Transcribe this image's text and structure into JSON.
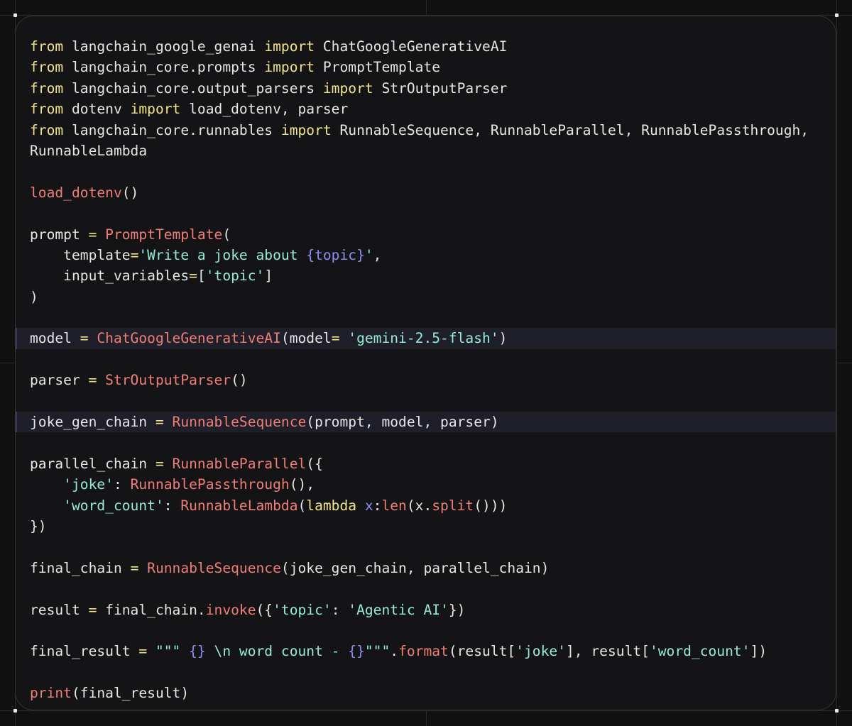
{
  "code_lines": [
    {
      "highlight": false,
      "tokens": [
        {
          "t": "kw",
          "v": "from"
        },
        {
          "t": "pl",
          "v": " langchain_google_genai "
        },
        {
          "t": "kw",
          "v": "import"
        },
        {
          "t": "pl",
          "v": " ChatGoogleGenerativeAI"
        }
      ]
    },
    {
      "highlight": false,
      "tokens": [
        {
          "t": "kw",
          "v": "from"
        },
        {
          "t": "pl",
          "v": " langchain_core.prompts "
        },
        {
          "t": "kw",
          "v": "import"
        },
        {
          "t": "pl",
          "v": " PromptTemplate"
        }
      ]
    },
    {
      "highlight": false,
      "tokens": [
        {
          "t": "kw",
          "v": "from"
        },
        {
          "t": "pl",
          "v": " langchain_core.output_parsers "
        },
        {
          "t": "kw",
          "v": "import"
        },
        {
          "t": "pl",
          "v": " StrOutputParser"
        }
      ]
    },
    {
      "highlight": false,
      "tokens": [
        {
          "t": "kw",
          "v": "from"
        },
        {
          "t": "pl",
          "v": " dotenv "
        },
        {
          "t": "kw",
          "v": "import"
        },
        {
          "t": "pl",
          "v": " load_dotenv, parser"
        }
      ]
    },
    {
      "highlight": false,
      "tokens": [
        {
          "t": "kw",
          "v": "from"
        },
        {
          "t": "pl",
          "v": " langchain_core.runnables "
        },
        {
          "t": "kw",
          "v": "import"
        },
        {
          "t": "pl",
          "v": " RunnableSequence, RunnableParallel, RunnablePassthrough,"
        }
      ]
    },
    {
      "highlight": false,
      "tokens": [
        {
          "t": "pl",
          "v": "RunnableLambda"
        }
      ]
    },
    {
      "highlight": false,
      "tokens": []
    },
    {
      "highlight": false,
      "tokens": [
        {
          "t": "fn",
          "v": "load_dotenv"
        },
        {
          "t": "pl",
          "v": "()"
        }
      ]
    },
    {
      "highlight": false,
      "tokens": []
    },
    {
      "highlight": false,
      "tokens": [
        {
          "t": "pl",
          "v": "prompt "
        },
        {
          "t": "op",
          "v": "="
        },
        {
          "t": "pl",
          "v": " "
        },
        {
          "t": "fn",
          "v": "PromptTemplate"
        },
        {
          "t": "pl",
          "v": "("
        }
      ]
    },
    {
      "highlight": false,
      "tokens": [
        {
          "t": "pl",
          "v": "    template"
        },
        {
          "t": "op",
          "v": "="
        },
        {
          "t": "str",
          "v": "'Write a joke about "
        },
        {
          "t": "ph",
          "v": "{topic}"
        },
        {
          "t": "str",
          "v": "'"
        },
        {
          "t": "pl",
          "v": ","
        }
      ]
    },
    {
      "highlight": false,
      "tokens": [
        {
          "t": "pl",
          "v": "    input_variables"
        },
        {
          "t": "op",
          "v": "="
        },
        {
          "t": "pl",
          "v": "["
        },
        {
          "t": "str",
          "v": "'topic'"
        },
        {
          "t": "pl",
          "v": "]"
        }
      ]
    },
    {
      "highlight": false,
      "tokens": [
        {
          "t": "pl",
          "v": ")"
        }
      ]
    },
    {
      "highlight": false,
      "tokens": []
    },
    {
      "highlight": true,
      "tokens": [
        {
          "t": "pl",
          "v": "model "
        },
        {
          "t": "op",
          "v": "="
        },
        {
          "t": "pl",
          "v": " "
        },
        {
          "t": "fn",
          "v": "ChatGoogleGenerativeAI"
        },
        {
          "t": "pl",
          "v": "(model"
        },
        {
          "t": "op",
          "v": "="
        },
        {
          "t": "pl",
          "v": " "
        },
        {
          "t": "str",
          "v": "'gemini-2.5-flash'"
        },
        {
          "t": "pl",
          "v": ")"
        }
      ]
    },
    {
      "highlight": false,
      "tokens": []
    },
    {
      "highlight": false,
      "tokens": [
        {
          "t": "pl",
          "v": "parser "
        },
        {
          "t": "op",
          "v": "="
        },
        {
          "t": "pl",
          "v": " "
        },
        {
          "t": "fn",
          "v": "StrOutputParser"
        },
        {
          "t": "pl",
          "v": "()"
        }
      ]
    },
    {
      "highlight": false,
      "tokens": []
    },
    {
      "highlight": true,
      "tokens": [
        {
          "t": "pl",
          "v": "joke_gen_chain "
        },
        {
          "t": "op",
          "v": "="
        },
        {
          "t": "pl",
          "v": " "
        },
        {
          "t": "fn",
          "v": "RunnableSequence"
        },
        {
          "t": "pl",
          "v": "(prompt, model, parser)"
        }
      ]
    },
    {
      "highlight": false,
      "tokens": []
    },
    {
      "highlight": false,
      "tokens": [
        {
          "t": "pl",
          "v": "parallel_chain "
        },
        {
          "t": "op",
          "v": "="
        },
        {
          "t": "pl",
          "v": " "
        },
        {
          "t": "fn",
          "v": "RunnableParallel"
        },
        {
          "t": "pl",
          "v": "({"
        }
      ]
    },
    {
      "highlight": false,
      "tokens": [
        {
          "t": "pl",
          "v": "    "
        },
        {
          "t": "str",
          "v": "'joke'"
        },
        {
          "t": "pl",
          "v": ": "
        },
        {
          "t": "fn",
          "v": "RunnablePassthrough"
        },
        {
          "t": "pl",
          "v": "(),"
        }
      ]
    },
    {
      "highlight": false,
      "tokens": [
        {
          "t": "pl",
          "v": "    "
        },
        {
          "t": "str",
          "v": "'word_count'"
        },
        {
          "t": "pl",
          "v": ": "
        },
        {
          "t": "fn",
          "v": "RunnableLambda"
        },
        {
          "t": "pl",
          "v": "("
        },
        {
          "t": "kw",
          "v": "lambda"
        },
        {
          "t": "pl",
          "v": " "
        },
        {
          "t": "ph",
          "v": "x"
        },
        {
          "t": "pl",
          "v": ":"
        },
        {
          "t": "fn",
          "v": "len"
        },
        {
          "t": "pl",
          "v": "(x."
        },
        {
          "t": "fn",
          "v": "split"
        },
        {
          "t": "pl",
          "v": "()))"
        }
      ]
    },
    {
      "highlight": false,
      "tokens": [
        {
          "t": "pl",
          "v": "})"
        }
      ]
    },
    {
      "highlight": false,
      "tokens": []
    },
    {
      "highlight": false,
      "tokens": [
        {
          "t": "pl",
          "v": "final_chain "
        },
        {
          "t": "op",
          "v": "="
        },
        {
          "t": "pl",
          "v": " "
        },
        {
          "t": "fn",
          "v": "RunnableSequence"
        },
        {
          "t": "pl",
          "v": "(joke_gen_chain, parallel_chain)"
        }
      ]
    },
    {
      "highlight": false,
      "tokens": []
    },
    {
      "highlight": false,
      "tokens": [
        {
          "t": "pl",
          "v": "result "
        },
        {
          "t": "op",
          "v": "="
        },
        {
          "t": "pl",
          "v": " final_chain."
        },
        {
          "t": "fn",
          "v": "invoke"
        },
        {
          "t": "pl",
          "v": "({"
        },
        {
          "t": "str",
          "v": "'topic'"
        },
        {
          "t": "pl",
          "v": ": "
        },
        {
          "t": "str",
          "v": "'Agentic AI'"
        },
        {
          "t": "pl",
          "v": "})"
        }
      ]
    },
    {
      "highlight": false,
      "tokens": []
    },
    {
      "highlight": false,
      "tokens": [
        {
          "t": "pl",
          "v": "final_result "
        },
        {
          "t": "op",
          "v": "="
        },
        {
          "t": "pl",
          "v": " "
        },
        {
          "t": "str",
          "v": "\"\"\" "
        },
        {
          "t": "ph",
          "v": "{}"
        },
        {
          "t": "str",
          "v": " \\n word count - "
        },
        {
          "t": "ph",
          "v": "{}"
        },
        {
          "t": "str",
          "v": "\"\"\""
        },
        {
          "t": "pl",
          "v": "."
        },
        {
          "t": "fn",
          "v": "format"
        },
        {
          "t": "pl",
          "v": "(result["
        },
        {
          "t": "str",
          "v": "'joke'"
        },
        {
          "t": "pl",
          "v": "], result["
        },
        {
          "t": "str",
          "v": "'word_count'"
        },
        {
          "t": "pl",
          "v": "])"
        }
      ]
    },
    {
      "highlight": false,
      "tokens": []
    },
    {
      "highlight": false,
      "tokens": [
        {
          "t": "fn",
          "v": "print"
        },
        {
          "t": "pl",
          "v": "(final_result)"
        }
      ]
    }
  ]
}
